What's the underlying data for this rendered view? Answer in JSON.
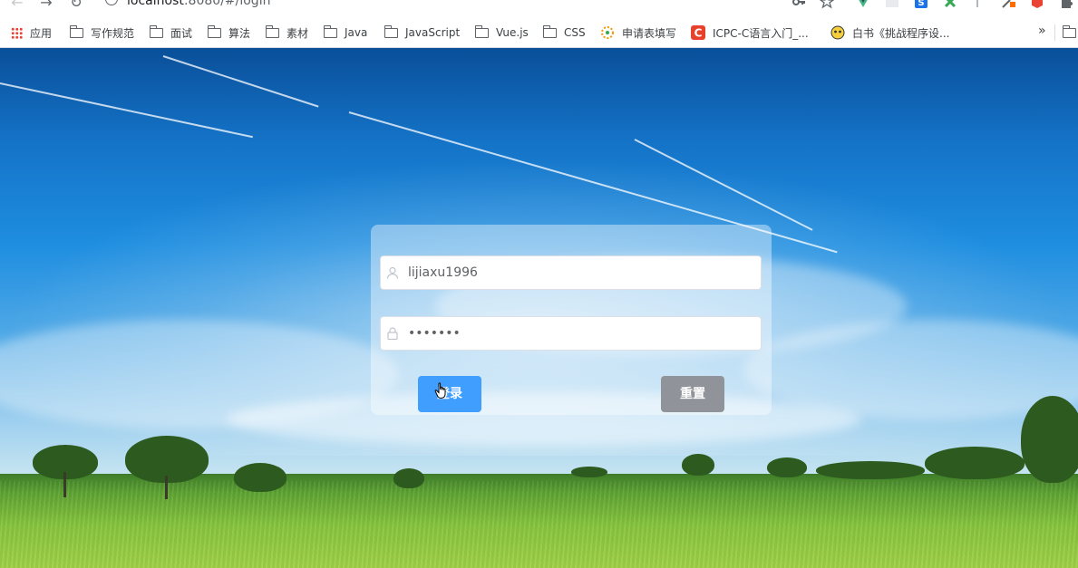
{
  "browser": {
    "url_host": "localhost",
    "url_rest": ":8080/#/login",
    "bookmarks": [
      {
        "label": "应用",
        "icon": "apps-grid-icon"
      },
      {
        "label": "写作规范",
        "icon": "folder-icon"
      },
      {
        "label": "面试",
        "icon": "folder-icon"
      },
      {
        "label": "算法",
        "icon": "folder-icon"
      },
      {
        "label": "素材",
        "icon": "folder-icon"
      },
      {
        "label": "Java",
        "icon": "folder-icon"
      },
      {
        "label": "JavaScript",
        "icon": "folder-icon"
      },
      {
        "label": "Vue.js",
        "icon": "folder-icon"
      },
      {
        "label": "CSS",
        "icon": "folder-icon"
      },
      {
        "label": "申请表填写",
        "icon": "site-favicon-icon"
      },
      {
        "label": "ICPC-C语言入门_...",
        "icon": "site-favicon-c-icon"
      },
      {
        "label": "白书《挑战程序设...",
        "icon": "site-favicon-icon"
      }
    ],
    "more_label": "»"
  },
  "login": {
    "username_value": "lijiaxu1996",
    "password_value": "1234567",
    "login_label": "登录",
    "reset_label": "重置"
  },
  "colors": {
    "primary": "#409eff",
    "info": "#909399"
  }
}
